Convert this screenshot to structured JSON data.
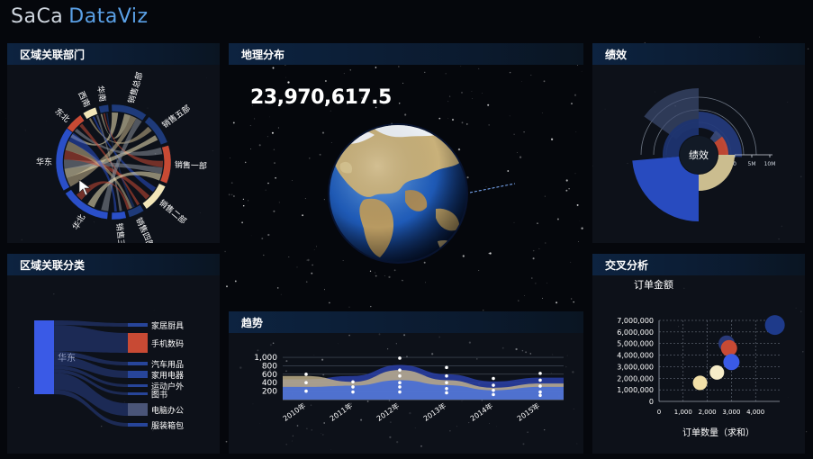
{
  "app": {
    "logo_left": "SaCa",
    "logo_right": "DataViz"
  },
  "panels": {
    "chord": {
      "title": "区域关联部门"
    },
    "geo": {
      "title": "地理分布",
      "total": "23,970,617.5"
    },
    "perf": {
      "title": "绩效",
      "center_label": "绩效",
      "scale_labels": [
        "0",
        "5M",
        "10M"
      ]
    },
    "sankey": {
      "title": "区域关联分类"
    },
    "trend": {
      "title": "趋势"
    },
    "cross": {
      "title": "交叉分析"
    }
  },
  "colors": {
    "red": "#c84a34",
    "cream": "#f2e6b8",
    "blue": "#2a4fc8",
    "navy": "#1e3a7a",
    "tan": "#c8b68c",
    "grey": "#8a8f99"
  },
  "chart_data": [
    {
      "id": "chord",
      "type": "chord",
      "left_nodes": [
        "东北",
        "西南",
        "华南",
        "华东",
        "华北"
      ],
      "right_nodes": [
        "销售总部",
        "销售五部",
        "销售一部",
        "销售二部",
        "销售四部",
        "销售三部"
      ]
    },
    {
      "id": "perf",
      "type": "polar-bar",
      "axis_labels": [
        "0",
        "5M",
        "10M"
      ],
      "center_label": "绩效"
    },
    {
      "id": "sankey",
      "type": "sankey",
      "source": "华东",
      "targets": [
        "家居厨具",
        "手机数码",
        "汽车用品",
        "家用电器",
        "运动户外",
        "图书",
        "电脑办公",
        "服装箱包"
      ]
    },
    {
      "id": "trend",
      "type": "area",
      "categories": [
        "2010年",
        "2011年",
        "2012年",
        "2013年",
        "2014年",
        "2015年"
      ],
      "yticks": [
        "200",
        "400",
        "600",
        "800",
        "1,000"
      ],
      "ylim": [
        0,
        1150
      ],
      "series": [
        {
          "values": [
            480,
            560,
            820,
            600,
            430,
            520
          ],
          "color": "#2a3fa8"
        },
        {
          "values": [
            560,
            420,
            700,
            460,
            280,
            380
          ],
          "color": "#c8b68c"
        },
        {
          "values": [
            300,
            330,
            460,
            340,
            220,
            300
          ],
          "color": "#3a66e0"
        }
      ],
      "points": [
        [
          600,
          400,
          200
        ],
        [
          420,
          300,
          180
        ],
        [
          980,
          700,
          560,
          400,
          300,
          180
        ],
        [
          760,
          560,
          400,
          260,
          160
        ],
        [
          500,
          340,
          220,
          120
        ],
        [
          620,
          460,
          320,
          180,
          100
        ]
      ]
    },
    {
      "id": "cross",
      "type": "scatter",
      "title": "订单金额",
      "xlabel": "订单数量（求和）",
      "xticks": [
        "0",
        "1,000",
        "2,000",
        "3,000",
        "4,000"
      ],
      "yticks": [
        "0",
        "1,000,000",
        "2,000,000",
        "3,000,000",
        "4,000,000",
        "5,000,000",
        "6,000,000",
        "7,000,000"
      ],
      "xlim": [
        0,
        5000
      ],
      "ylim": [
        0,
        7000000
      ],
      "points": [
        {
          "x": 1700,
          "y": 1600000,
          "r": 8,
          "color": "#f2e0a8"
        },
        {
          "x": 2400,
          "y": 2500000,
          "r": 8,
          "color": "#f6ecc8"
        },
        {
          "x": 2800,
          "y": 5000000,
          "r": 9,
          "color": "#2a3a7a"
        },
        {
          "x": 2900,
          "y": 4600000,
          "r": 9,
          "color": "#c84a34"
        },
        {
          "x": 3000,
          "y": 3400000,
          "r": 9,
          "color": "#3a5ae6"
        },
        {
          "x": 4800,
          "y": 6600000,
          "r": 11,
          "color": "#1e3a8a"
        }
      ]
    }
  ]
}
